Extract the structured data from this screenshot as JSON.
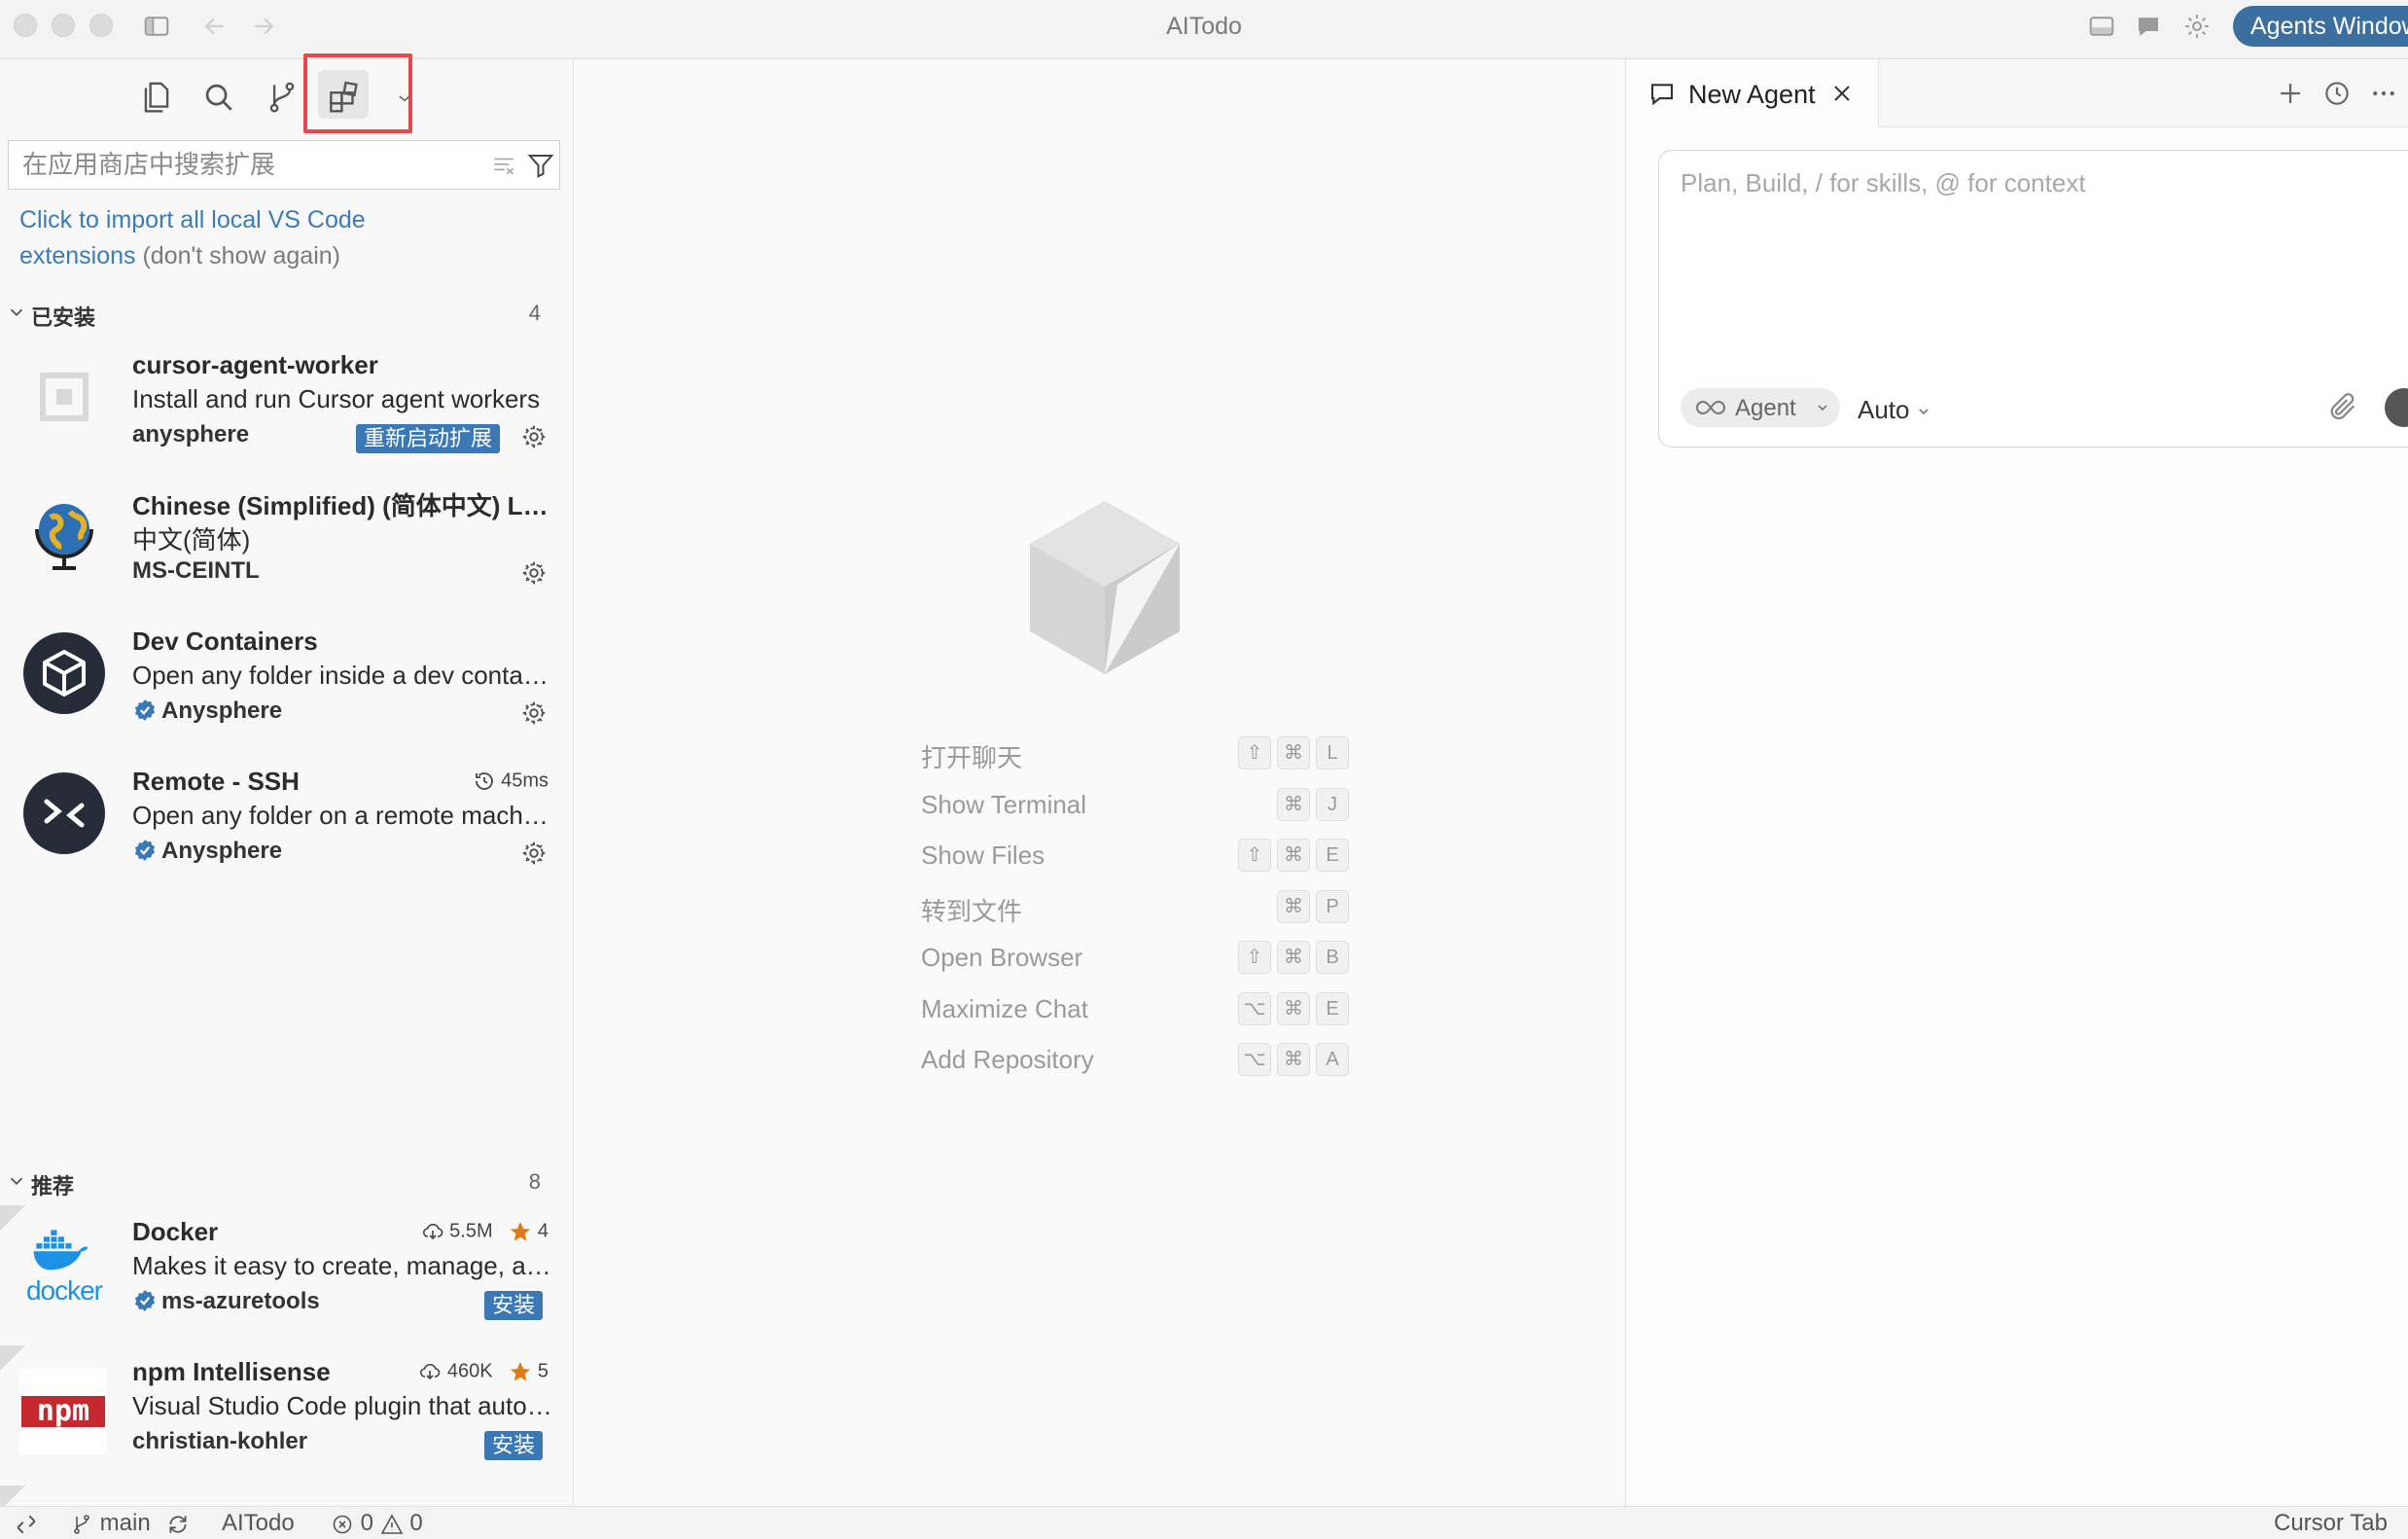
{
  "window": {
    "title": "AITodo",
    "agents_button": "Agents Window"
  },
  "sidebar": {
    "search_placeholder": "在应用商店中搜索扩展",
    "import_link": "Click to import all local VS Code extensions",
    "import_dismiss": "(don't show again)",
    "installed": {
      "label": "已安装",
      "count": "4",
      "items": [
        {
          "name": "cursor-agent-worker",
          "description": "Install and run Cursor agent workers",
          "publisher": "anysphere",
          "badge": "重新启动扩展"
        },
        {
          "name": "Chinese (Simplified) (简体中文) Language Pack",
          "description": "中文(简体)",
          "publisher": "MS-CEINTL"
        },
        {
          "name": "Dev Containers",
          "description": "Open any folder inside a dev container",
          "publisher": "Anysphere"
        },
        {
          "name": "Remote - SSH",
          "description": "Open any folder on a remote machine",
          "publisher": "Anysphere",
          "timing": "45ms"
        }
      ]
    },
    "recommended": {
      "label": "推荐",
      "count": "8",
      "items": [
        {
          "name": "Docker",
          "description": "Makes it easy to create, manage, and debug",
          "publisher": "ms-azuretools",
          "downloads": "5.5M",
          "rating": "4",
          "install_label": "安装",
          "logo_text": "docker"
        },
        {
          "name": "npm Intellisense",
          "description": "Visual Studio Code plugin that autocompletes",
          "publisher": "christian-kohler",
          "downloads": "460K",
          "rating": "5",
          "install_label": "安装",
          "logo_text": "npm"
        }
      ]
    }
  },
  "editor": {
    "shortcuts": [
      {
        "label": "打开聊天",
        "keys": [
          "⇧",
          "⌘",
          "L"
        ]
      },
      {
        "label": "Show Terminal",
        "keys": [
          "⌘",
          "J"
        ]
      },
      {
        "label": "Show Files",
        "keys": [
          "⇧",
          "⌘",
          "E"
        ]
      },
      {
        "label": "转到文件",
        "keys": [
          "⌘",
          "P"
        ]
      },
      {
        "label": "Open Browser",
        "keys": [
          "⇧",
          "⌘",
          "B"
        ]
      },
      {
        "label": "Maximize Chat",
        "keys": [
          "⌥",
          "⌘",
          "E"
        ]
      },
      {
        "label": "Add Repository",
        "keys": [
          "⌥",
          "⌘",
          "A"
        ]
      }
    ]
  },
  "agent_panel": {
    "tab_label": "New Agent",
    "placeholder": "Plan, Build, / for skills, @ for context",
    "mode": "Agent",
    "model": "Auto"
  },
  "status_bar": {
    "branch": "main",
    "project": "AITodo",
    "errors": "0",
    "warnings": "0",
    "right_label": "Cursor Tab"
  },
  "colors": {
    "accent": "#3b6fa0",
    "highlight": "#e5484d",
    "badge": "#3b79b6",
    "star": "#e07a16"
  }
}
